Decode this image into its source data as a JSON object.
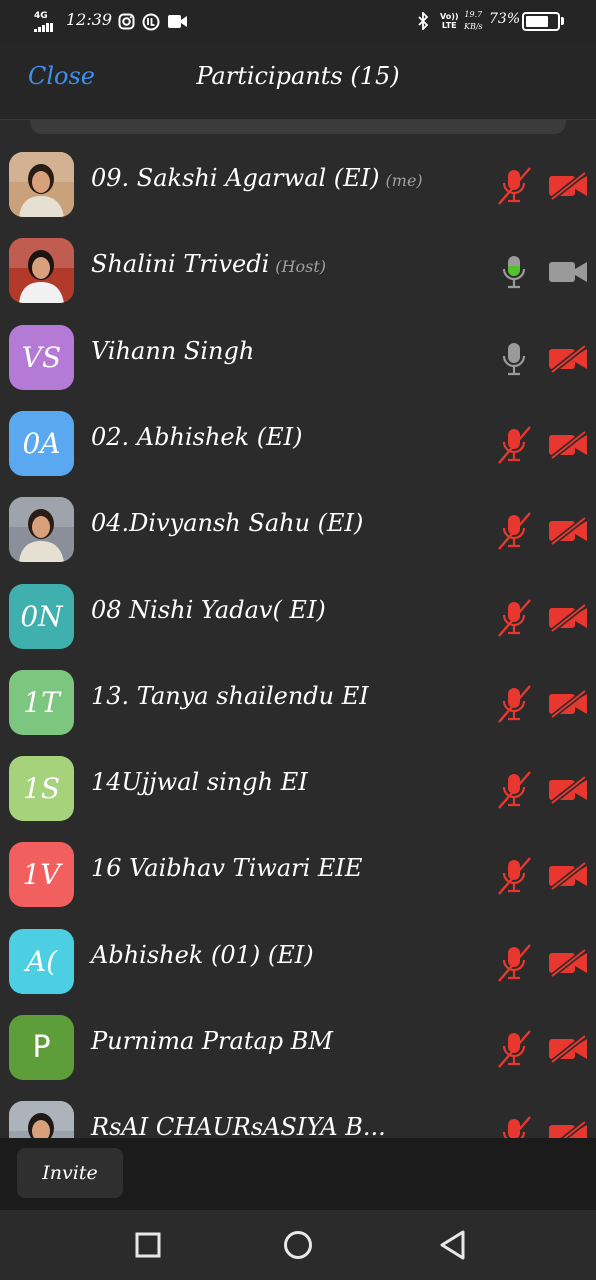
{
  "status_bar": {
    "network": "4G",
    "time": "12:39",
    "volte": [
      "Vo))",
      "LTE"
    ],
    "speed": [
      "19.7",
      "KB/s"
    ],
    "battery": "73%",
    "battery_level": 0.73
  },
  "header": {
    "close_label": "Close",
    "title": "Participants (15)"
  },
  "participants": [
    {
      "name": "09. Sakshi Agarwal (EI)",
      "tag": "(me)",
      "avatar_type": "photo",
      "avatar_initials": "",
      "avatar_color": "#c9a27c",
      "mic": "muted",
      "video": "off"
    },
    {
      "name": "Shalini Trivedi",
      "tag": "(Host)",
      "avatar_type": "photo",
      "avatar_initials": "",
      "avatar_color": "#b23a2a",
      "mic": "speaking",
      "video": "on"
    },
    {
      "name": "Vihann Singh",
      "tag": "",
      "avatar_type": "initials",
      "avatar_initials": "VS",
      "avatar_color": "#b57ad6",
      "mic": "on",
      "video": "off"
    },
    {
      "name": "02. Abhishek (EI)",
      "tag": "",
      "avatar_type": "initials",
      "avatar_initials": "0A",
      "avatar_color": "#5aa8f0",
      "mic": "muted",
      "video": "off"
    },
    {
      "name": "04.Divyansh Sahu (EI)",
      "tag": "",
      "avatar_type": "photo",
      "avatar_initials": "",
      "avatar_color": "#8a8f99",
      "mic": "muted",
      "video": "off"
    },
    {
      "name": "08 Nishi Yadav( EI)",
      "tag": "",
      "avatar_type": "initials",
      "avatar_initials": "0N",
      "avatar_color": "#3fb0ad",
      "mic": "muted",
      "video": "off"
    },
    {
      "name": "13. Tanya shailendu EI",
      "tag": "",
      "avatar_type": "initials",
      "avatar_initials": "1T",
      "avatar_color": "#7cc67f",
      "mic": "muted",
      "video": "off"
    },
    {
      "name": "14Ujjwal singh EI",
      "tag": "",
      "avatar_type": "initials",
      "avatar_initials": "1S",
      "avatar_color": "#a5d27a",
      "mic": "muted",
      "video": "off"
    },
    {
      "name": "16 Vaibhav Tiwari EIE",
      "tag": "",
      "avatar_type": "initials",
      "avatar_initials": "1V",
      "avatar_color": "#f25f5f",
      "mic": "muted",
      "video": "off"
    },
    {
      "name": "Abhishek (01) (EI)",
      "tag": "",
      "avatar_type": "initials",
      "avatar_initials": "A(",
      "avatar_color": "#4dcfe3",
      "mic": "muted",
      "video": "off"
    },
    {
      "name": "Purnima Pratap BM",
      "tag": "",
      "avatar_type": "initials-plain",
      "avatar_initials": "P",
      "avatar_color": "#5e9e3a",
      "mic": "muted",
      "video": "off"
    },
    {
      "name": "RsAI CHAURsASIYA B...",
      "tag": "",
      "avatar_type": "photo",
      "avatar_initials": "",
      "avatar_color": "#9aa3ad",
      "mic": "muted",
      "video": "off"
    }
  ],
  "footer": {
    "invite_label": "Invite"
  },
  "colors": {
    "muted_red": "#e8372f",
    "speaking_green": "#53c22b",
    "icon_gray": "#9a9a9a",
    "accent_blue": "#3d8ff0"
  },
  "icons": {
    "nav_recents": "square-icon",
    "nav_home": "circle-icon",
    "nav_back": "triangle-back-icon"
  }
}
